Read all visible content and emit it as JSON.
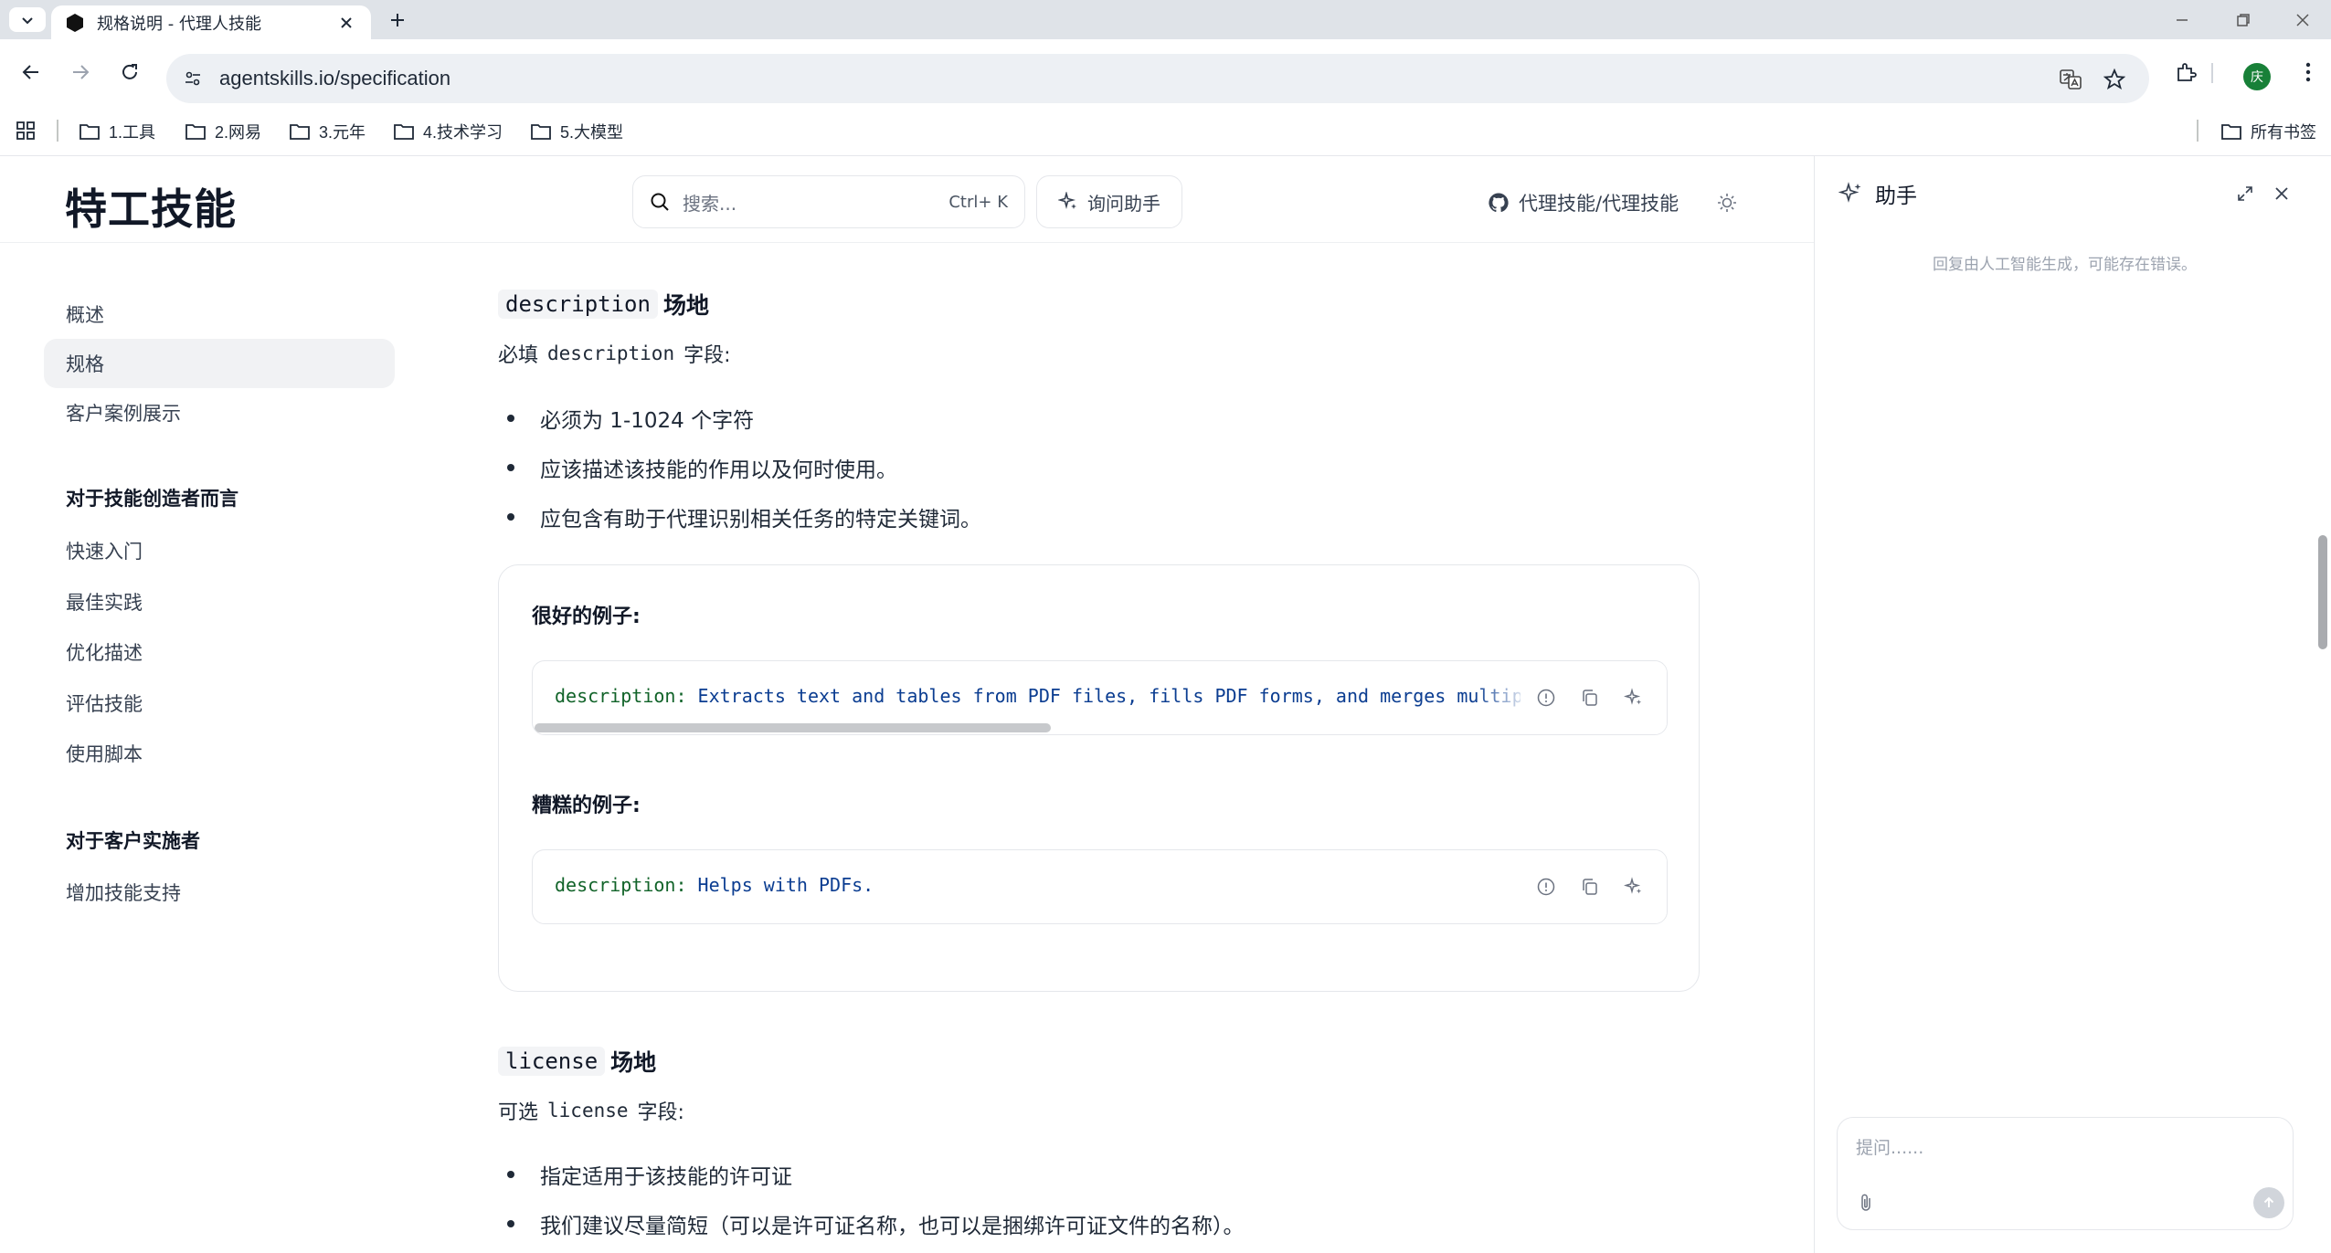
{
  "browser": {
    "tab_title": "规格说明 - 代理人技能",
    "url": "agentskills.io/specification",
    "profile_initial": "庆",
    "bookmarks": [
      "1.工具",
      "2.网易",
      "3.元年",
      "4.技术学习",
      "5.大模型"
    ],
    "all_bookmarks": "所有书签"
  },
  "header": {
    "logo": "特工技能",
    "search_placeholder": "搜索...",
    "search_shortcut": "Ctrl+ K",
    "ask_label": "询问助手",
    "github_label": "代理技能/代理技能"
  },
  "sidebar": {
    "items": [
      {
        "label": "概述",
        "active": false
      },
      {
        "label": "规格",
        "active": true
      },
      {
        "label": "客户案例展示",
        "active": false
      }
    ],
    "group_creators": {
      "title": "对于技能创造者而言",
      "items": [
        "快速入门",
        "最佳实践",
        "优化描述",
        "评估技能",
        "使用脚本"
      ]
    },
    "group_clients": {
      "title": "对于客户实施者",
      "items": [
        "增加技能支持"
      ]
    }
  },
  "content": {
    "description_section": {
      "code": "description",
      "heading_suffix": "场地",
      "intro_prefix": "必填",
      "intro_code": "description",
      "intro_suffix": "字段:",
      "bullets": [
        "必须为 1-1024 个字符",
        "应该描述该技能的作用以及何时使用。",
        "应包含有助于代理识别相关任务的特定关键词。"
      ],
      "good_label": "很好的例子:",
      "good_code_key": "description:",
      "good_code_value": "Extracts text and tables from PDF files, fills PDF forms, and merges multiple PDFs.",
      "bad_label": "糟糕的例子:",
      "bad_code_key": "description:",
      "bad_code_value": "Helps with PDFs."
    },
    "license_section": {
      "code": "license",
      "heading_suffix": "场地",
      "intro_prefix": "可选",
      "intro_code": "license",
      "intro_suffix": "字段:",
      "bullets": [
        "指定适用于该技能的许可证",
        "我们建议尽量简短（可以是许可证名称，也可以是捆绑许可证文件的名称）。"
      ]
    }
  },
  "assistant": {
    "title": "助手",
    "disclaimer": "回复由人工智能生成，可能存在错误。",
    "input_placeholder": "提问......"
  },
  "colors": {
    "accent_green": "#188038",
    "code_key": "#116329",
    "code_value": "#0b3d91"
  }
}
